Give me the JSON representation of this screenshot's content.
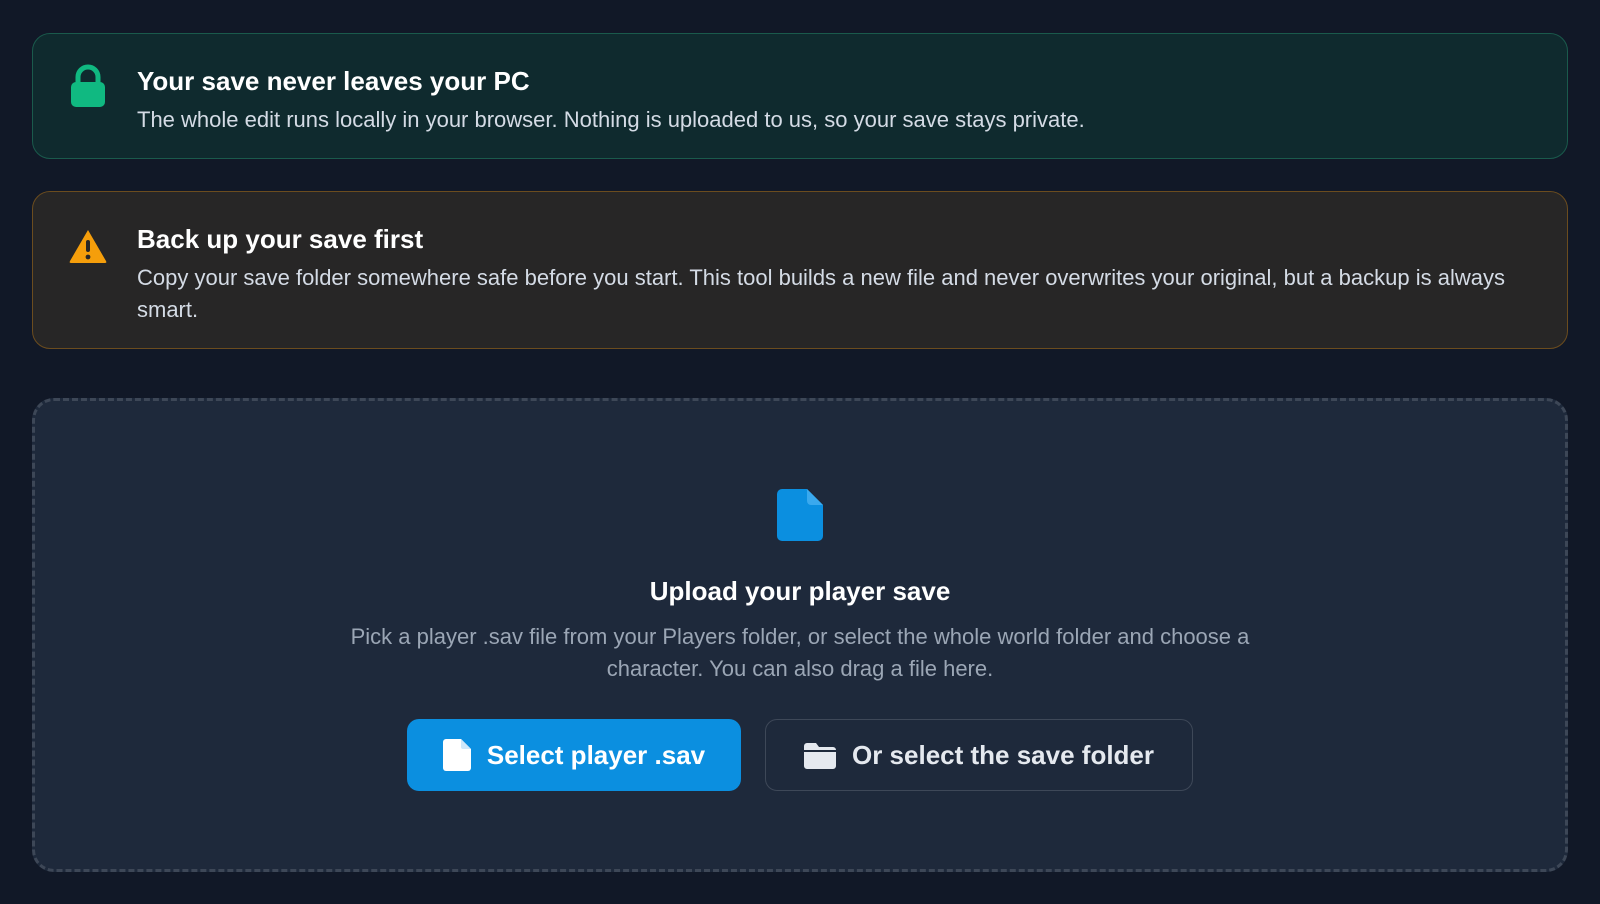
{
  "privacy_notice": {
    "title": "Your save never leaves your PC",
    "text": "The whole edit runs locally in your browser. Nothing is uploaded to us, so your save stays private.",
    "icon": "lock-icon",
    "accent_color": "#10b981"
  },
  "backup_notice": {
    "title": "Back up your save first",
    "text": "Copy your save folder somewhere safe before you start. This tool builds a new file and never overwrites your original, but a backup is always smart.",
    "icon": "warning-icon",
    "accent_color": "#f59e0b"
  },
  "upload": {
    "icon": "file-icon",
    "title": "Upload your player save",
    "description": "Pick a player .sav file from your Players folder, or select the whole world folder and choose a character. You can also drag a file here.",
    "primary_button": {
      "label": "Select player .sav",
      "icon": "file-icon"
    },
    "secondary_button": {
      "label": "Or select the save folder",
      "icon": "folder-icon"
    },
    "accent_color": "#0b8fe0"
  }
}
